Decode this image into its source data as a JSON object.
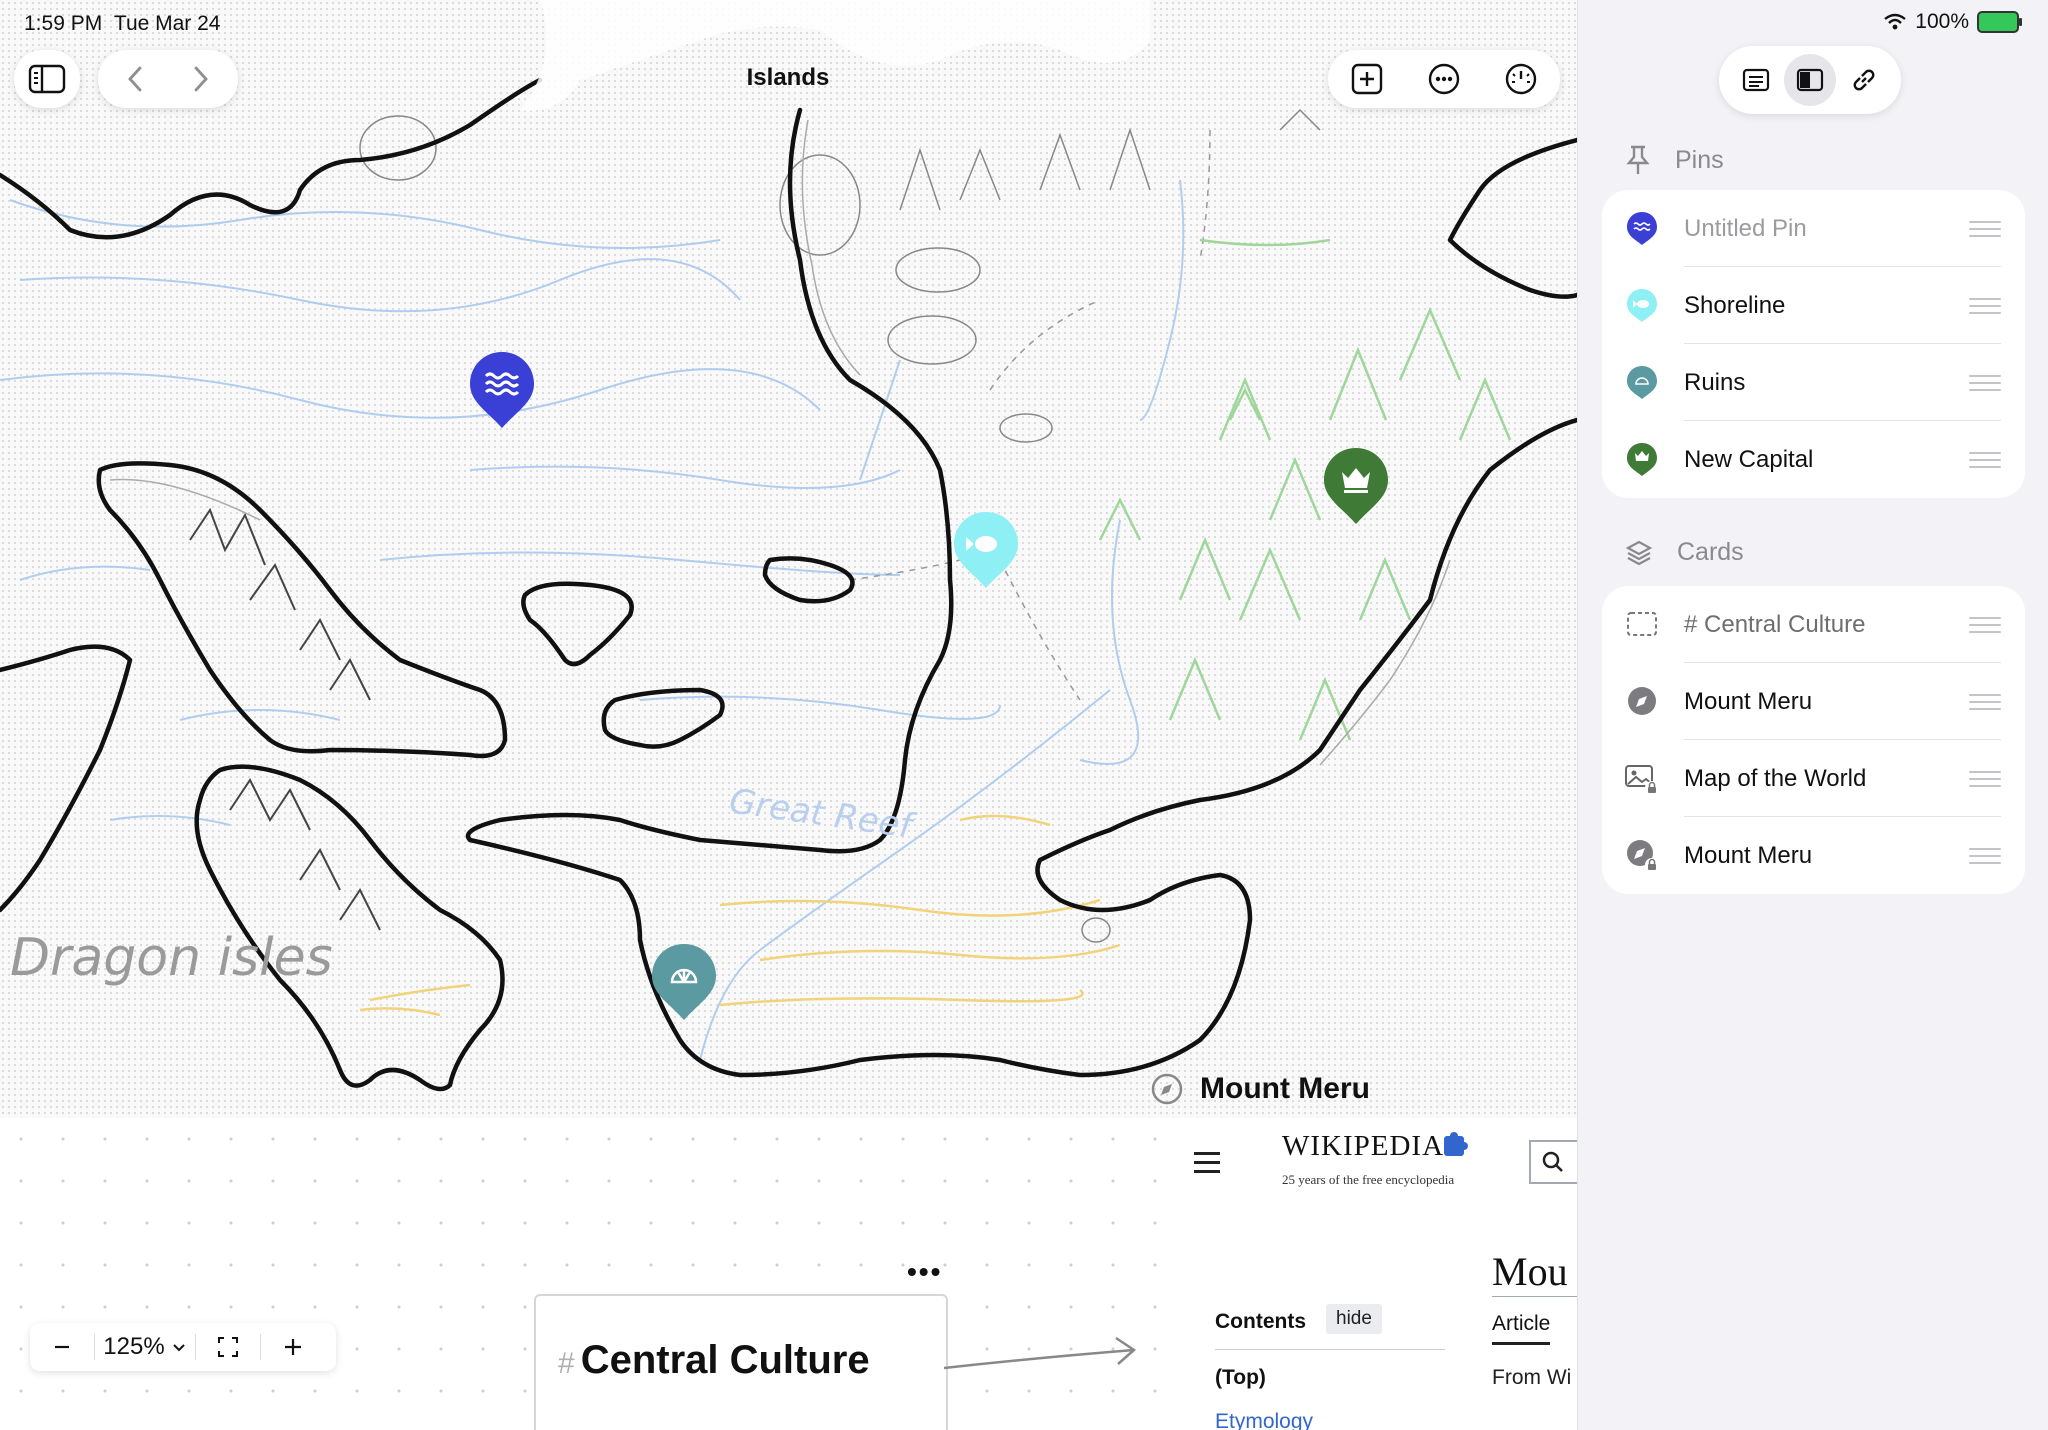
{
  "status_bar": {
    "time": "1:59 PM",
    "date": "Tue Mar 24",
    "battery": "100%"
  },
  "toolbar": {
    "title": "Islands"
  },
  "map_labels": {
    "dragon_isles": "Dragon isles",
    "great_reef": "Great Reef"
  },
  "sidebar": {
    "pins_header": "Pins",
    "pins": [
      {
        "label": "Untitled Pin",
        "muted": true,
        "color": "#3a3fd6",
        "icon": "waves-icon"
      },
      {
        "label": "Shoreline",
        "muted": false,
        "color": "#8ef0f5",
        "icon": "fish-icon"
      },
      {
        "label": "Ruins",
        "muted": false,
        "color": "#5b9aa0",
        "icon": "shell-icon"
      },
      {
        "label": "New Capital",
        "muted": false,
        "color": "#3f7a36",
        "icon": "crown-icon"
      }
    ],
    "cards_header": "Cards",
    "cards": [
      {
        "label": "# Central Culture",
        "muted": false,
        "icon": "dashed-card-icon"
      },
      {
        "label": "Mount Meru",
        "muted": false,
        "icon": "compass-icon"
      },
      {
        "label": "Map of the World",
        "muted": false,
        "icon": "locked-image-icon"
      },
      {
        "label": "Mount Meru",
        "muted": false,
        "icon": "locked-compass-icon"
      }
    ]
  },
  "zoom": {
    "level": "125%"
  },
  "card": {
    "hash": "#",
    "title": "Central Culture"
  },
  "web_card": {
    "title": "Mount Meru",
    "wiki_logo": "WIKIPEDIA",
    "wiki_tagline": "25 years of the free encyclopedia",
    "article_title": "Mou",
    "contents_label": "Contents",
    "hide_label": "hide",
    "toc_top": "(Top)",
    "toc_item": "Etymology",
    "article_tab": "Article",
    "intro_fragment": "From Wi"
  },
  "colors": {
    "sidebar_bg": "#f2f2f7",
    "pin_blue": "#3a3fd6",
    "pin_cyan": "#8ef0f5",
    "pin_teal": "#5b9aa0",
    "pin_green": "#3f7a36"
  }
}
